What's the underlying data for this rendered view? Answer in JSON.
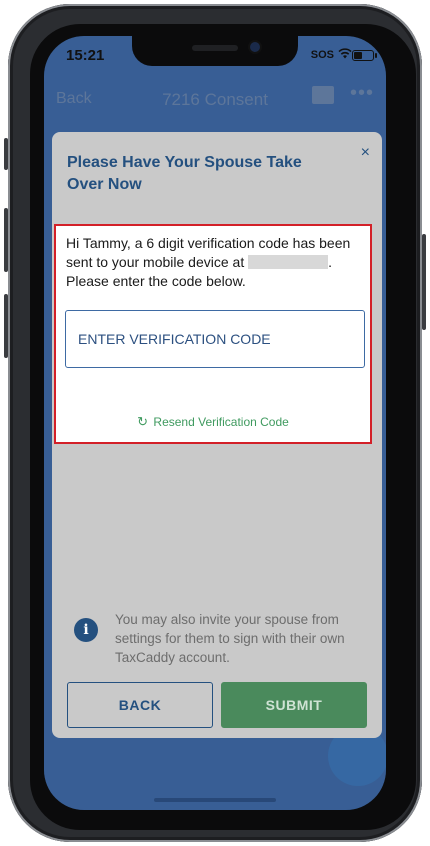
{
  "status_bar": {
    "time": "15:21",
    "carrier": "SOS"
  },
  "app_bar": {
    "back_label": "Back",
    "title": "7216 Consent",
    "more_label": "•••"
  },
  "modal": {
    "title": "Please Have Your Spouse Take Over Now",
    "close_icon": "×",
    "intro_before": "Hi Tammy, a 6 digit verification code has been sent to your mobile device at",
    "intro_after": ". Please enter the code below.",
    "code_placeholder": "ENTER VERIFICATION CODE",
    "resend_icon": "↻",
    "resend_label": "Resend Verification Code",
    "info_icon": "i",
    "info_text": "You may also invite your spouse from settings for them to sign with their own TaxCaddy account.",
    "back_button": "BACK",
    "submit_button": "SUBMIT"
  },
  "colors": {
    "app_blue": "#2f5d9e",
    "modal_title": "#24507f",
    "highlight_border": "#d32028",
    "resend_green": "#3f9a5f",
    "submit_green": "#4a8a5c"
  },
  "icons": [
    "wifi-icon",
    "battery-icon",
    "chat-icon",
    "more-icon",
    "close-icon",
    "refresh-icon",
    "info-icon"
  ]
}
